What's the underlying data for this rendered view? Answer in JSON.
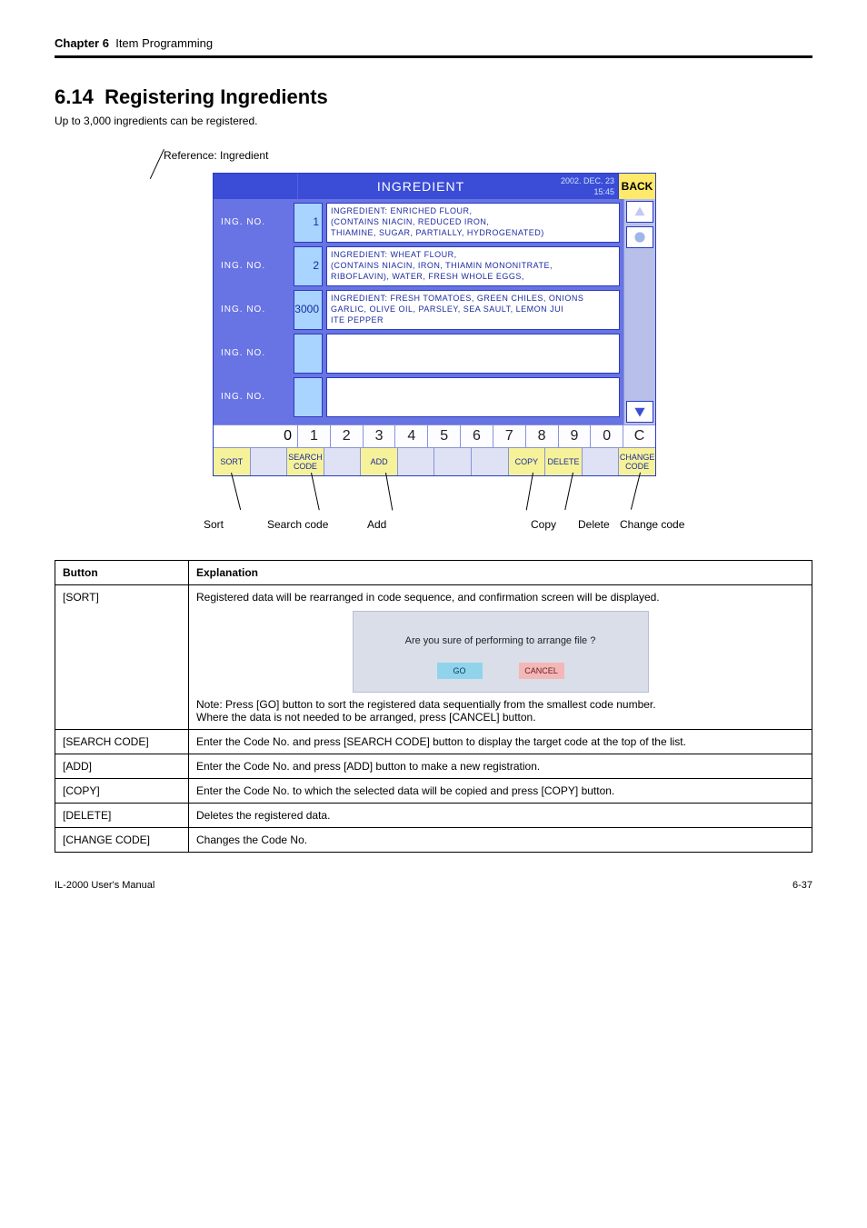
{
  "header": {
    "chapter": "Chapter 6",
    "chapter_title": "Item Programming",
    "section_number": "6.14",
    "section_title": "Registering Ingredients",
    "note": "Up to 3,000 ingredients can be registered."
  },
  "labels_above": {
    "ingredient_ref": "Reference: Ingredient"
  },
  "screen": {
    "title": "INGREDIENT",
    "datetime_line1": "2002. DEC. 23",
    "datetime_line2": "15:45",
    "back": "BACK",
    "rows": [
      {
        "label": "ING. NO.",
        "num": "1",
        "text": "INGREDIENT: ENRICHED FLOUR,\n(CONTAINS NIACIN, REDUCED IRON,\nTHIAMINE, SUGAR, PARTIALLY, HYDROGENATED)"
      },
      {
        "label": "ING. NO.",
        "num": "2",
        "text": "INGREDIENT: WHEAT FLOUR,\n(CONTAINS NIACIN, IRON, THIAMIN MONONITRATE,\nRIBOFLAVIN), WATER, FRESH WHOLE EGGS,"
      },
      {
        "label": "ING. NO.",
        "num": "3000",
        "text": "INGREDIENT: FRESH TOMATOES, GREEN CHILES, ONIONS\nGARLIC, OLIVE OIL, PARSLEY, SEA SAULT, LEMON JUI\nITE PEPPER"
      },
      {
        "label": "ING. NO.",
        "num": "",
        "text": ""
      },
      {
        "label": "ING. NO.",
        "num": "",
        "text": ""
      }
    ],
    "display_value": "0",
    "numkeys": [
      "1",
      "2",
      "3",
      "4",
      "5",
      "6",
      "7",
      "8",
      "9",
      "0",
      "C"
    ],
    "fbuttons": {
      "sort": "SORT",
      "search_code": "SEARCH\nCODE",
      "add": "ADD",
      "copy": "COPY",
      "delete": "DELETE",
      "change_code": "CHANGE\nCODE"
    }
  },
  "callouts": {
    "sort": "Sort",
    "search": "Search code",
    "add": "Add",
    "copy": "Copy",
    "delete": "Delete",
    "change": "Change code"
  },
  "table": {
    "h_button": "Button",
    "h_expl": "Explanation",
    "rows": [
      {
        "btn": "[SORT]",
        "text_top": "Registered data will be rearranged in code sequence, and confirmation screen will be displayed.",
        "note": "Note: Press [GO] button to sort the registered data sequentially from the smallest code number.\nWhere the data is not needed to be arranged, press [CANCEL] button."
      },
      {
        "btn": "[SEARCH CODE]",
        "text": "Enter the Code No. and press [SEARCH CODE] button to display the target code at the top of the list."
      },
      {
        "btn": "[ADD]",
        "text": "Enter the Code No. and press [ADD] button to make a new registration."
      },
      {
        "btn": "[COPY]",
        "text": "Enter the Code No. to which the selected data will be copied and press [COPY] button."
      },
      {
        "btn": "[DELETE]",
        "text": "Deletes the registered data."
      },
      {
        "btn": "[CHANGE CODE]",
        "text": "Changes the Code No."
      }
    ],
    "dialog": {
      "msg": "Are you sure of performing to arrange file ?",
      "go": "GO",
      "cancel": "CANCEL"
    }
  },
  "footer": {
    "left": "IL-2000 User's Manual",
    "right": "6-37"
  }
}
